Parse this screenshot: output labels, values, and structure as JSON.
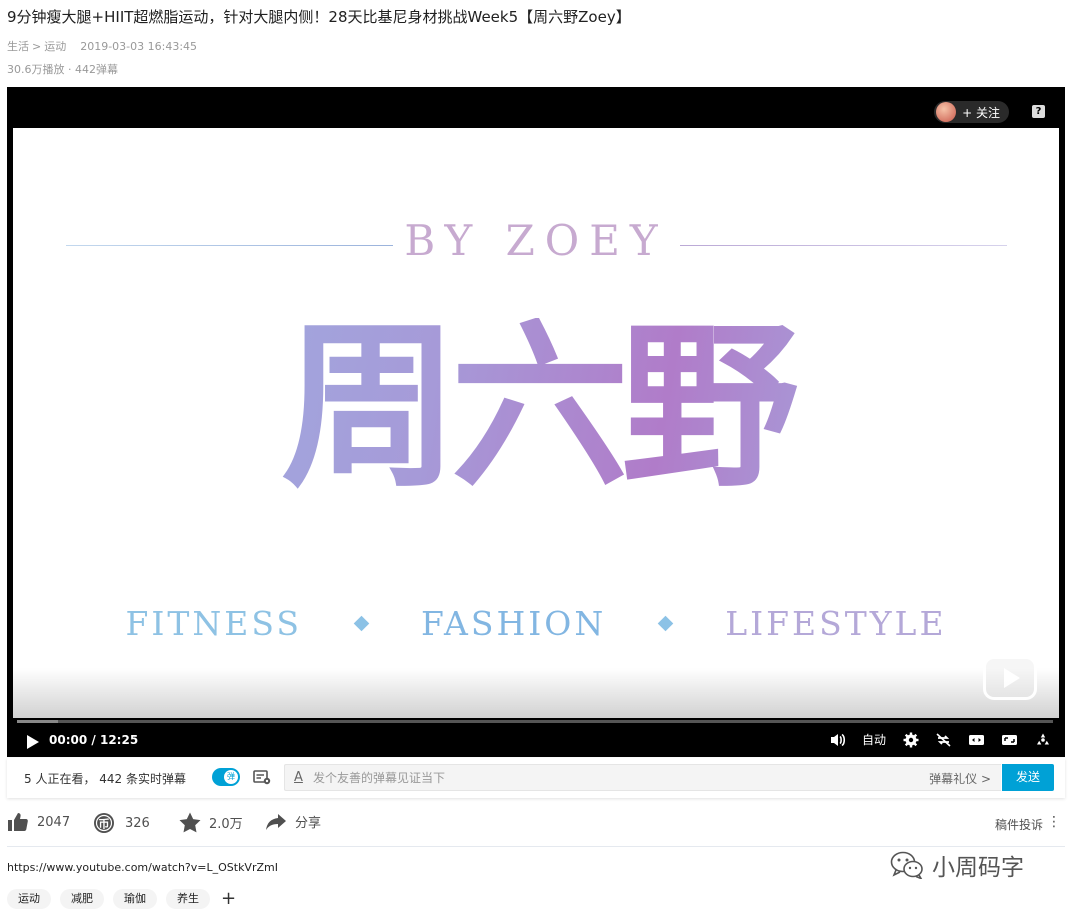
{
  "video": {
    "title": "9分钟瘦大腿+HIIT超燃脂运动，针对大腿内侧！28天比基尼身材挑战Week5【周六野Zoey】",
    "category": "生活",
    "subcategory": "运动",
    "category_sep": ">",
    "date": "2019-03-03 16:43:45",
    "stats": "30.6万播放 · 442弹幕"
  },
  "player": {
    "follow_label": "+ 关注",
    "help_label": "?",
    "frame": {
      "byline": "BY ZOEY",
      "brand": "周六野",
      "tagline": [
        "FITNESS",
        "FASHION",
        "LIFESTYLE"
      ]
    },
    "progress_fraction": 0.04,
    "time_current": "00:00",
    "time_sep": "/",
    "time_total": "12:25",
    "quality_label": "自动"
  },
  "danmaku": {
    "viewers_text": "5 人正在看，  442 条实时弹幕",
    "toggle_label": "弹",
    "placeholder": "发个友善的弹幕见证当下",
    "etiquette": "弹幕礼仪 >",
    "send_label": "发送"
  },
  "actions": {
    "like_count": "2047",
    "coin_count": "326",
    "favorite_count": "2.0万",
    "share_label": "分享",
    "report_label": "稿件投诉",
    "more_label": "⋮"
  },
  "description": {
    "url": "https://www.youtube.com/watch?v=L_OStkVrZmI"
  },
  "tags": [
    "运动",
    "减肥",
    "瑜伽",
    "养生"
  ],
  "tag_add_label": "+",
  "watermark": {
    "text": "小周码字",
    "icon": "wechat-icon"
  },
  "colors": {
    "accent": "#00a1d6",
    "player_bg": "#000000",
    "muted_text": "#999999"
  }
}
